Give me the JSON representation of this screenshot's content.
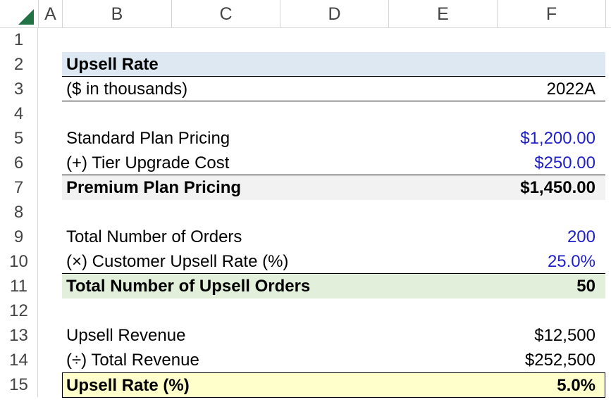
{
  "columns": [
    "A",
    "B",
    "C",
    "D",
    "E",
    "F"
  ],
  "rows": [
    "1",
    "2",
    "3",
    "4",
    "5",
    "6",
    "7",
    "8",
    "9",
    "10",
    "11",
    "12",
    "13",
    "14",
    "15"
  ],
  "sheet": {
    "title": "Upsell Rate",
    "units": "($ in thousands)",
    "period": "2022A",
    "standard_label": "Standard Plan Pricing",
    "standard_value": "$1,200.00",
    "upgrade_label": "(+) Tier Upgrade Cost",
    "upgrade_value": "$250.00",
    "premium_label": "Premium Plan Pricing",
    "premium_value": "$1,450.00",
    "orders_label": "Total Number of Orders",
    "orders_value": "200",
    "upsell_rate_in_label": "(×) Customer Upsell Rate (%)",
    "upsell_rate_in_value": "25.0%",
    "upsell_orders_label": "Total Number of Upsell Orders",
    "upsell_orders_value": "50",
    "upsell_revenue_label": "Upsell Revenue",
    "upsell_revenue_value": "$12,500",
    "total_revenue_label": "(÷) Total Revenue",
    "total_revenue_value": "$252,500",
    "upsell_rate_label": "Upsell Rate (%)",
    "upsell_rate_value": "5.0%"
  },
  "colors": {
    "title_fill": "#dde8f3",
    "premium_fill": "#f2f2f2",
    "upsell_orders_fill": "#e2efda",
    "result_fill": "#ffffcc",
    "input_text": "#1f1fc8"
  }
}
